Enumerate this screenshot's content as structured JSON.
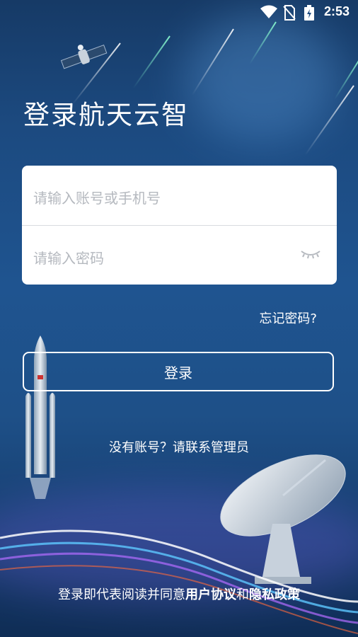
{
  "status_bar": {
    "time": "2:53",
    "icons": [
      "wifi-icon",
      "no-sim-icon",
      "battery-charging-icon"
    ]
  },
  "page_title": "登录航天云智",
  "form": {
    "account_placeholder": "请输入账号或手机号",
    "password_placeholder": "请输入密码",
    "password_toggle_icon": "eye-closed-icon"
  },
  "forgot_password": "忘记密码?",
  "login_button": "登录",
  "no_account_text": "没有账号？请联系管理员",
  "agreement": {
    "prefix": "登录即代表阅读并同意",
    "user_agreement": "用户协议",
    "and": "和",
    "privacy_policy": "隐私政策"
  },
  "background": {
    "colors": {
      "top": "#163a66",
      "middle": "#1f5490",
      "bottom": "#0f2d55"
    },
    "illustrations": [
      "satellite",
      "rocket",
      "radar-dish",
      "meteors",
      "light-streaks"
    ]
  }
}
